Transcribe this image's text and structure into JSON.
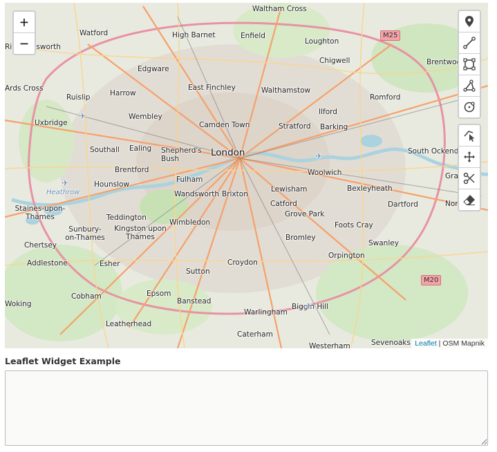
{
  "map": {
    "zoom_in": "+",
    "zoom_out": "−",
    "places": [
      {
        "name": "Waltham Cross"
      },
      {
        "name": "Watford"
      },
      {
        "name": "High Barnet"
      },
      {
        "name": "Enfield"
      },
      {
        "name": "Loughton"
      },
      {
        "name": "Rickmansworth"
      },
      {
        "name": "Chigwell"
      },
      {
        "name": "Brentwood"
      },
      {
        "name": "Edgware"
      },
      {
        "name": "East Finchley"
      },
      {
        "name": "Walthamstow"
      },
      {
        "name": "Harrow"
      },
      {
        "name": "Ruislip"
      },
      {
        "name": "Romford"
      },
      {
        "name": "Wembley"
      },
      {
        "name": "Ilford"
      },
      {
        "name": "Uxbridge"
      },
      {
        "name": "Camden Town"
      },
      {
        "name": "Stratford"
      },
      {
        "name": "Barking"
      },
      {
        "name": "Southall"
      },
      {
        "name": "Ealing"
      },
      {
        "name": "Shepherd's Bush"
      },
      {
        "name": "London"
      },
      {
        "name": "South Ockendon"
      },
      {
        "name": "Brentford"
      },
      {
        "name": "Woolwich"
      },
      {
        "name": "Fulham"
      },
      {
        "name": "Hounslow"
      },
      {
        "name": "Lewisham"
      },
      {
        "name": "Bexleyheath"
      },
      {
        "name": "Heathrow"
      },
      {
        "name": "Wandsworth"
      },
      {
        "name": "Brixton"
      },
      {
        "name": "Catford"
      },
      {
        "name": "Dartford"
      },
      {
        "name": "Staines-upon-Thames"
      },
      {
        "name": "Teddington"
      },
      {
        "name": "Grove Park"
      },
      {
        "name": "Wimbledon"
      },
      {
        "name": "Foots Cray"
      },
      {
        "name": "Sunbury-on-Thames"
      },
      {
        "name": "Kingston upon Thames"
      },
      {
        "name": "Bromley"
      },
      {
        "name": "Chertsey"
      },
      {
        "name": "Swanley"
      },
      {
        "name": "Orpington"
      },
      {
        "name": "Addlestone"
      },
      {
        "name": "Esher"
      },
      {
        "name": "Croydon"
      },
      {
        "name": "Sutton"
      },
      {
        "name": "Cobham"
      },
      {
        "name": "Epsom"
      },
      {
        "name": "Banstead"
      },
      {
        "name": "Biggin Hill"
      },
      {
        "name": "Woking"
      },
      {
        "name": "Warlingham"
      },
      {
        "name": "Leatherhead"
      },
      {
        "name": "Caterham"
      },
      {
        "name": "Sevenoaks"
      },
      {
        "name": "Westerham"
      },
      {
        "name": "Ards Cross"
      },
      {
        "name": "Gray"
      },
      {
        "name": "Nort"
      }
    ],
    "shields": [
      {
        "name": "M25"
      },
      {
        "name": "M20"
      }
    ],
    "attribution": {
      "leaflet": "Leaflet",
      "separator": " | ",
      "tiles": "OSM Mapnik"
    }
  },
  "toolbar_draw": [
    {
      "icon": "marker-icon"
    },
    {
      "icon": "polyline-icon"
    },
    {
      "icon": "rectangle-icon"
    },
    {
      "icon": "polygon-icon"
    },
    {
      "icon": "circle-icon"
    }
  ],
  "toolbar_edit": [
    {
      "icon": "edit-icon"
    },
    {
      "icon": "move-icon"
    },
    {
      "icon": "cut-icon"
    },
    {
      "icon": "eraser-icon"
    }
  ],
  "widget": {
    "label": "Leaflet Widget Example",
    "textarea_value": ""
  }
}
